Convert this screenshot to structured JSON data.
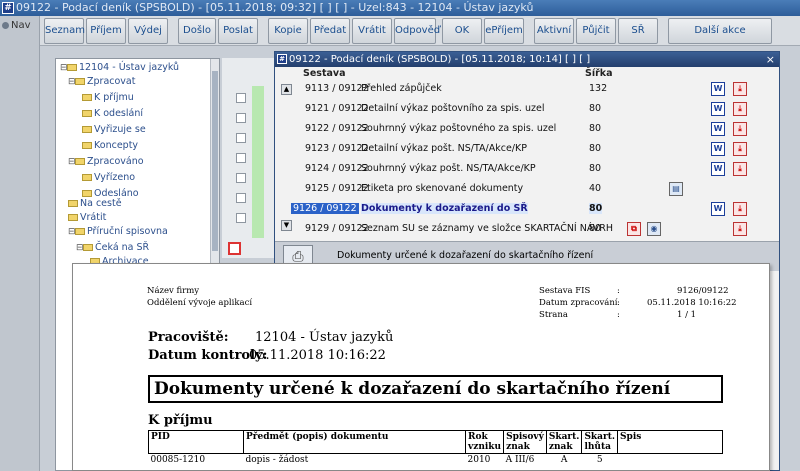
{
  "window": {
    "title": "09122 - Podací deník (SPSBOLD) - [05.11.2018; 09:32]  [ ]  [ ] - Uzel:843 - 12104 - Ústav jazyků",
    "app_icon": "#"
  },
  "nav": {
    "label": "Nav"
  },
  "toolbar": {
    "buttons": [
      "Seznam",
      "Příjem",
      "Výdej",
      "Došlo",
      "Poslat",
      "Kopie",
      "Předat",
      "Vrátit",
      "Odpověď",
      "OK",
      "ePříjem",
      "Aktivní",
      "Půjčit",
      "SŘ",
      "Další akce"
    ]
  },
  "tree": {
    "items": [
      {
        "label": "12104 - Ústav jazyků",
        "prefix": "⊟"
      },
      {
        "label": "Zpracovat",
        "prefix": "⊟"
      },
      {
        "label": "K příjmu",
        "prefix": ""
      },
      {
        "label": "K odeslání",
        "prefix": ""
      },
      {
        "label": "Vyřizuje se",
        "prefix": ""
      },
      {
        "label": "Koncepty",
        "prefix": ""
      },
      {
        "label": "Zpracováno",
        "prefix": "⊟"
      },
      {
        "label": "Vyřízeno",
        "prefix": ""
      },
      {
        "label": "Odesláno",
        "prefix": ""
      },
      {
        "label": "Na cestě",
        "prefix": ""
      },
      {
        "label": "Vrátit",
        "prefix": ""
      },
      {
        "label": "Příruční spisovna",
        "prefix": "⊟"
      },
      {
        "label": "Čeká na SŘ",
        "prefix": "⊟"
      },
      {
        "label": "Archivace",
        "prefix": ""
      }
    ]
  },
  "dialog": {
    "title": "09122 - Podací deník (SPSBOLD) - [05.11.2018; 10:14]  [ ]  [ ]",
    "header_sestava": "Sestava",
    "header_sirka": "Šířka",
    "rows": [
      {
        "code": "9113 / 09122",
        "name": "Přehled zápůjček",
        "width": "132"
      },
      {
        "code": "9121 / 09122",
        "name": "Detailní výkaz poštovního za spis. uzel",
        "width": "80"
      },
      {
        "code": "9122 / 09122",
        "name": "Souhrnný výkaz poštovného za spis. uzel",
        "width": "80"
      },
      {
        "code": "9123 / 09122",
        "name": "Detailní výkaz pošt. NS/TA/Akce/KP",
        "width": "80"
      },
      {
        "code": "9124 / 09122",
        "name": "Souhrnný výkaz pošt. NS/TA/Akce/KP",
        "width": "80"
      },
      {
        "code": "9125 / 09122",
        "name": "Etiketa pro skenované dokumenty",
        "width": "40"
      },
      {
        "code": "9126 / 09122",
        "name": "Dokumenty k dozařazení do SŘ",
        "width": "80"
      },
      {
        "code": "9129 / 09122",
        "name": "Seznam SU se záznamy ve složce SKARTAČNÍ NÁVRH",
        "width": "80"
      }
    ],
    "selected_code_a": "9126",
    "selected_code_b": " / 09122",
    "description": "Dokumenty určené k dozařazení do skartačního řízení"
  },
  "report": {
    "firm_label": "Název firmy",
    "dept": "Oddělení vývoje aplikací",
    "sestava_label": "Sestava FIS",
    "sestava_value": "9126/09122",
    "datum_label": "Datum zpracování",
    "datum_value": "05.11.2018 10:16:22",
    "strana_label": "Strana",
    "strana_value": "1 / 1",
    "colon": ":",
    "pracoviste_label": "Pracoviště:",
    "pracoviste_value": "12104 - Ústav jazyků",
    "kontrola_label": "Datum kontroly:",
    "kontrola_value": "05.11.2018 10:16:22",
    "title": "Dokumenty určené k dozařazení do skartačního řízení",
    "section": "K příjmu",
    "columns": [
      "PID",
      "Předmět (popis) dokumentu",
      "Rok vzniku",
      "Spisový znak",
      "Skart. znak",
      "Skart. lhůta",
      "Spis"
    ],
    "rows": [
      {
        "pid": "00085-1210",
        "predmet": "dopis - žádost",
        "rok": "2010",
        "spisovy": "A III/6",
        "skznak": "A",
        "lhuta": "5",
        "spis": ""
      }
    ]
  }
}
